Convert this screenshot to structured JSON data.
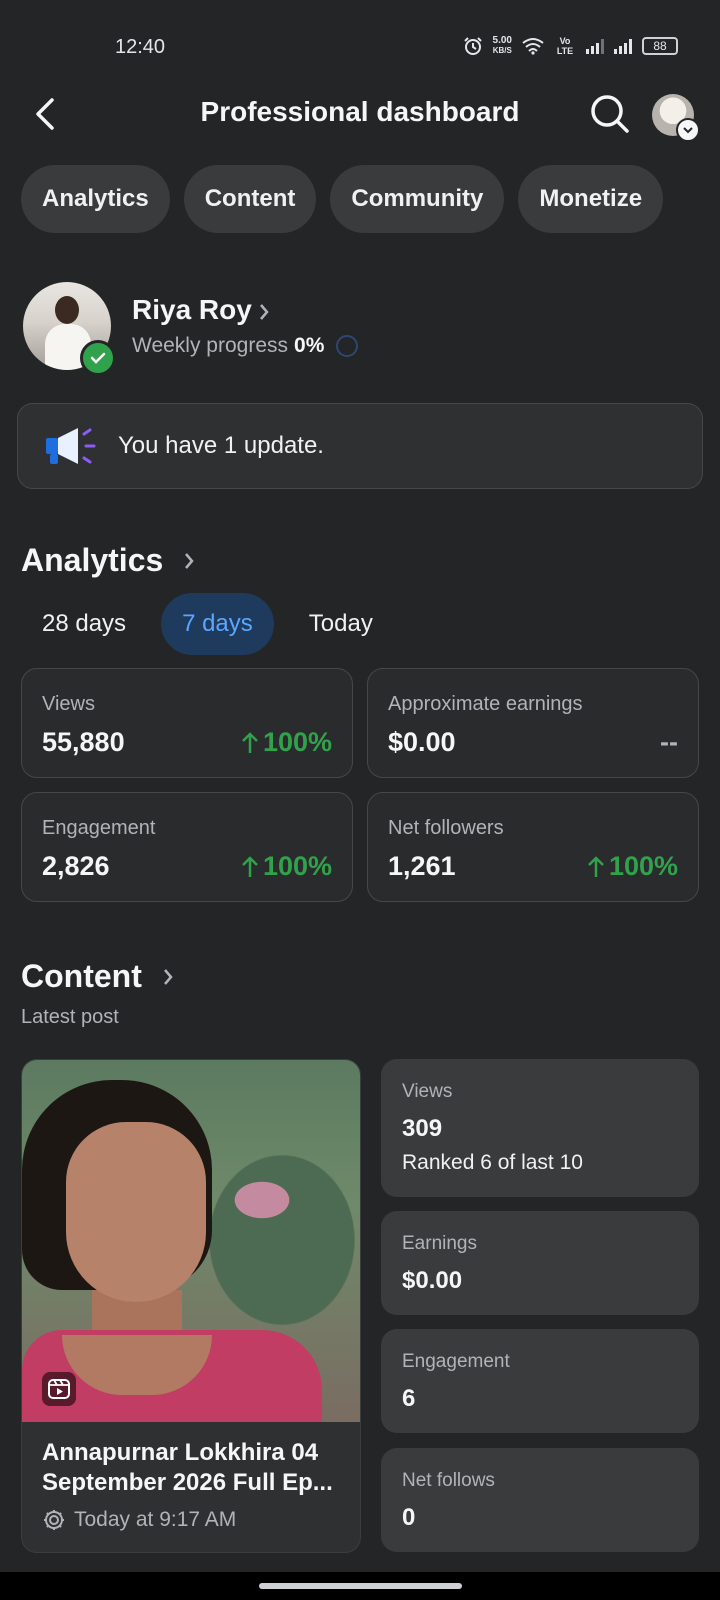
{
  "status": {
    "time": "12:40",
    "netspeed_value": "5.00",
    "netspeed_unit": "KB/S",
    "volte": "Vo LTE",
    "battery": "88"
  },
  "header": {
    "title": "Professional dashboard"
  },
  "tabs": [
    "Analytics",
    "Content",
    "Community",
    "Monetize"
  ],
  "profile": {
    "name": "Riya Roy",
    "weekly_label": "Weekly progress",
    "weekly_value": "0%"
  },
  "update": {
    "text": "You have 1 update."
  },
  "analytics": {
    "title": "Analytics",
    "ranges": [
      "28 days",
      "7 days",
      "Today"
    ],
    "selected_range": "7 days",
    "cards": [
      {
        "label": "Views",
        "value": "55,880",
        "delta": "100%"
      },
      {
        "label": "Approximate earnings",
        "value": "$0.00",
        "delta": "--"
      },
      {
        "label": "Engagement",
        "value": "2,826",
        "delta": "100%"
      },
      {
        "label": "Net followers",
        "value": "1,261",
        "delta": "100%"
      }
    ]
  },
  "content": {
    "title": "Content",
    "subtitle": "Latest post",
    "post": {
      "title": "Annapurnar Lokkhira 04 September 2026 Full Ep...",
      "time": "Today at 9:17 AM"
    },
    "stats": [
      {
        "label": "Views",
        "value": "309",
        "sub": "Ranked 6 of last 10"
      },
      {
        "label": "Earnings",
        "value": "$0.00"
      },
      {
        "label": "Engagement",
        "value": "6"
      },
      {
        "label": "Net follows",
        "value": "0"
      }
    ]
  },
  "colors": {
    "background": "#242526",
    "card": "#2a2b2c",
    "positive": "#31a24c",
    "accent": "#5aa7ff",
    "verified": "#31a24c"
  }
}
